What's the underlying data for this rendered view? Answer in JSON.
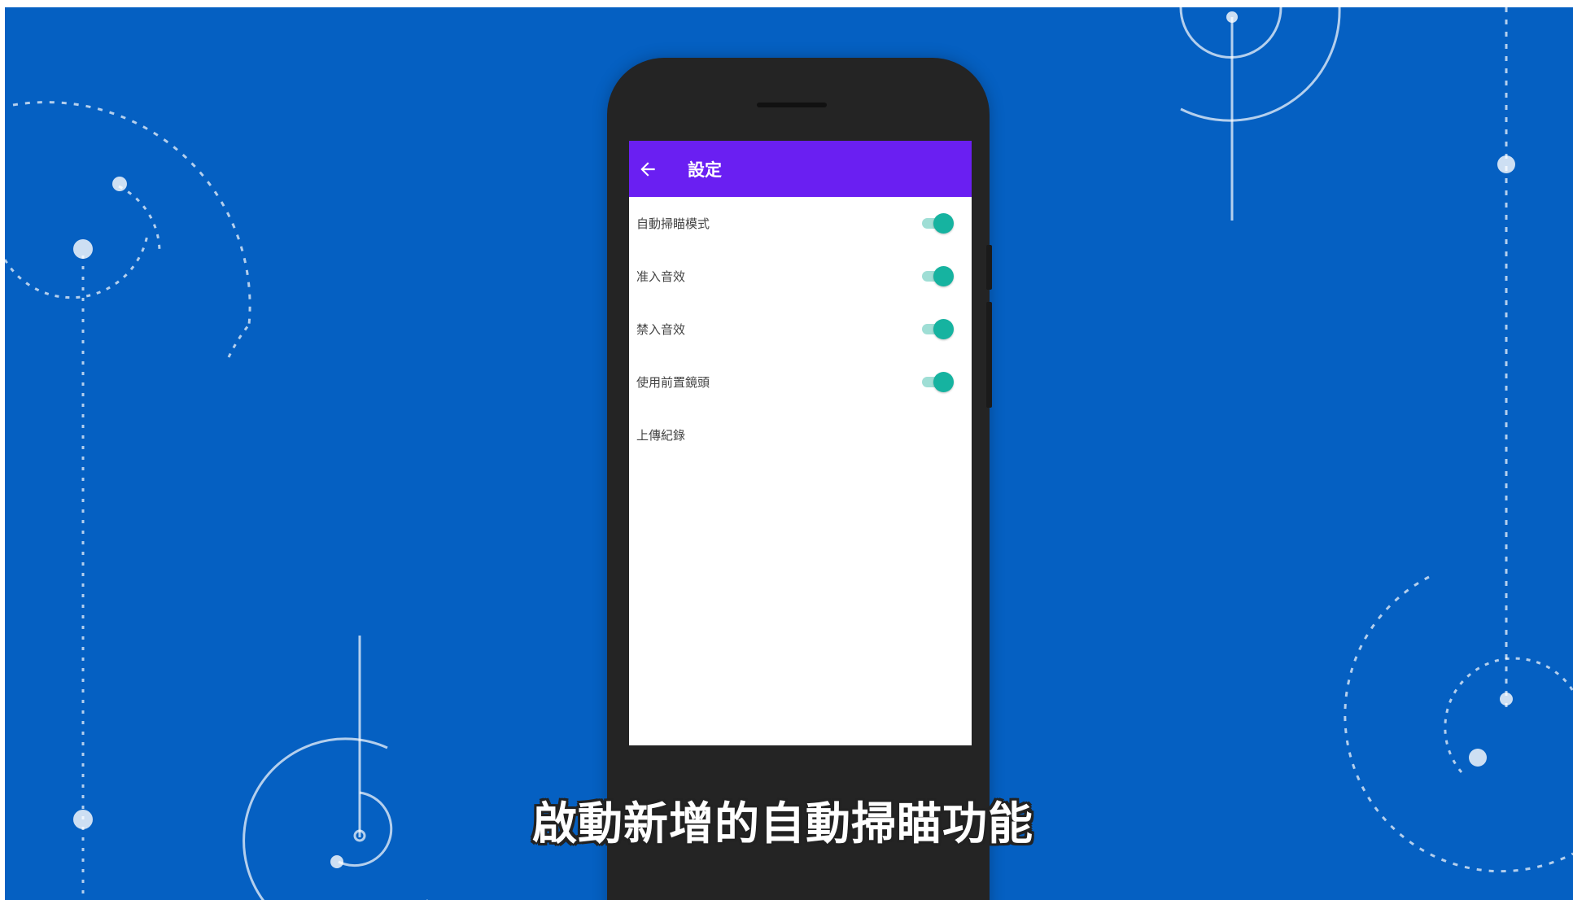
{
  "appbar": {
    "title": "設定",
    "back_icon": "arrow-left-icon"
  },
  "settings": [
    {
      "label": "自動掃瞄模式",
      "enabled": true
    },
    {
      "label": "准入音效",
      "enabled": true
    },
    {
      "label": "禁入音效",
      "enabled": true
    },
    {
      "label": "使用前置鏡頭",
      "enabled": true
    },
    {
      "label": "上傳紀錄",
      "enabled": null
    }
  ],
  "subtitle": "啟動新增的自動掃瞄功能",
  "colors": {
    "background": "#0560c2",
    "appbar": "#6a1ff2",
    "toggle_on": "#16b3a0"
  }
}
